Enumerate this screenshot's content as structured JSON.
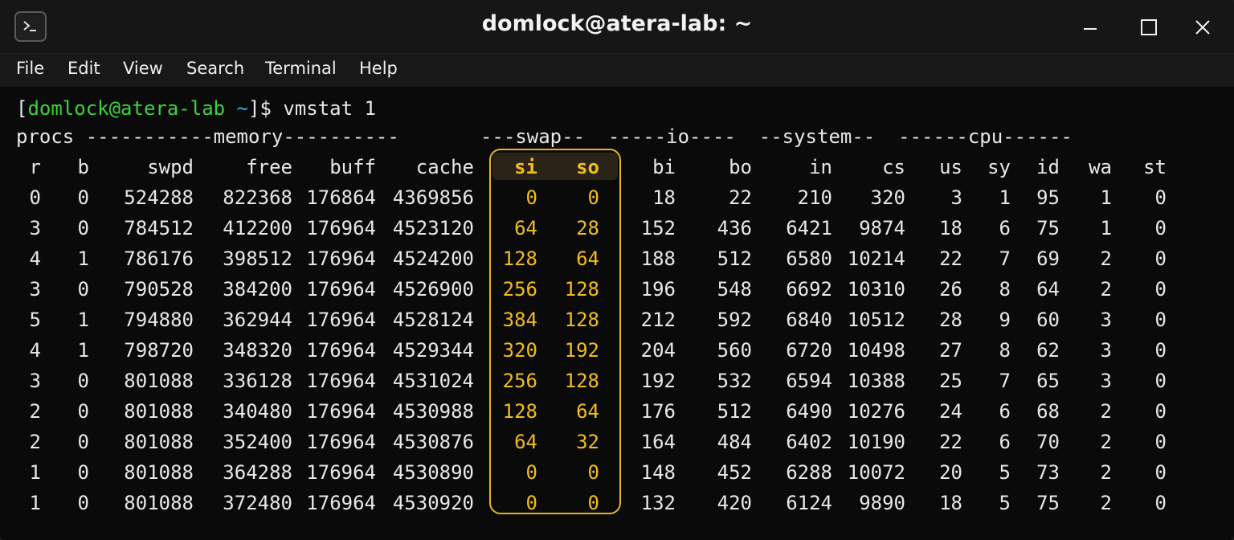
{
  "window": {
    "title": "domlock@atera-lab: ~",
    "accent": "#f2bd1d"
  },
  "icons": {
    "app": "terminal-icon",
    "minimize": "minimize-icon",
    "maximize": "maximize-icon",
    "close": "close-icon"
  },
  "menu": [
    "File",
    "Edit",
    "View",
    "Search",
    "Terminal",
    "Help"
  ],
  "prompt": {
    "open": "[",
    "user_host": "domlock@atera-lab",
    "path": " ~",
    "close": "]$ ",
    "command": "vmstat 1"
  },
  "vmstat": {
    "group_header": "procs -----------memory----------       ---swap--  -----io----  --system--  ------cpu------",
    "columns": [
      "r",
      "b",
      "swpd",
      "free",
      "buff",
      "cache",
      "si",
      "so",
      "bi",
      "bo",
      "in",
      "cs",
      "us",
      "sy",
      "id",
      "wa",
      "st"
    ],
    "rows": [
      [
        "0",
        "0",
        "524288",
        "822368",
        "176864",
        "4369856",
        "0",
        "0",
        "18",
        "22",
        "210",
        "320",
        "3",
        "1",
        "95",
        "1",
        "0"
      ],
      [
        "3",
        "0",
        "784512",
        "412200",
        "176964",
        "4523120",
        "64",
        "28",
        "152",
        "436",
        "6421",
        "9874",
        "18",
        "6",
        "75",
        "1",
        "0"
      ],
      [
        "4",
        "1",
        "786176",
        "398512",
        "176964",
        "4524200",
        "128",
        "64",
        "188",
        "512",
        "6580",
        "10214",
        "22",
        "7",
        "69",
        "2",
        "0"
      ],
      [
        "3",
        "0",
        "790528",
        "384200",
        "176964",
        "4526900",
        "256",
        "128",
        "196",
        "548",
        "6692",
        "10310",
        "26",
        "8",
        "64",
        "2",
        "0"
      ],
      [
        "5",
        "1",
        "794880",
        "362944",
        "176964",
        "4528124",
        "384",
        "128",
        "212",
        "592",
        "6840",
        "10512",
        "28",
        "9",
        "60",
        "3",
        "0"
      ],
      [
        "4",
        "1",
        "798720",
        "348320",
        "176964",
        "4529344",
        "320",
        "192",
        "204",
        "560",
        "6720",
        "10498",
        "27",
        "8",
        "62",
        "3",
        "0"
      ],
      [
        "3",
        "0",
        "801088",
        "336128",
        "176964",
        "4531024",
        "256",
        "128",
        "192",
        "532",
        "6594",
        "10388",
        "25",
        "7",
        "65",
        "3",
        "0"
      ],
      [
        "2",
        "0",
        "801088",
        "340480",
        "176964",
        "4530988",
        "128",
        "64",
        "176",
        "512",
        "6490",
        "10276",
        "24",
        "6",
        "68",
        "2",
        "0"
      ],
      [
        "2",
        "0",
        "801088",
        "352400",
        "176964",
        "4530876",
        "64",
        "32",
        "164",
        "484",
        "6402",
        "10190",
        "22",
        "6",
        "70",
        "2",
        "0"
      ],
      [
        "1",
        "0",
        "801088",
        "364288",
        "176964",
        "4530890",
        "0",
        "0",
        "148",
        "452",
        "6288",
        "10072",
        "20",
        "5",
        "73",
        "2",
        "0"
      ],
      [
        "1",
        "0",
        "801088",
        "372480",
        "176964",
        "4530920",
        "0",
        "0",
        "132",
        "420",
        "6124",
        "9890",
        "18",
        "5",
        "75",
        "2",
        "0"
      ]
    ]
  }
}
